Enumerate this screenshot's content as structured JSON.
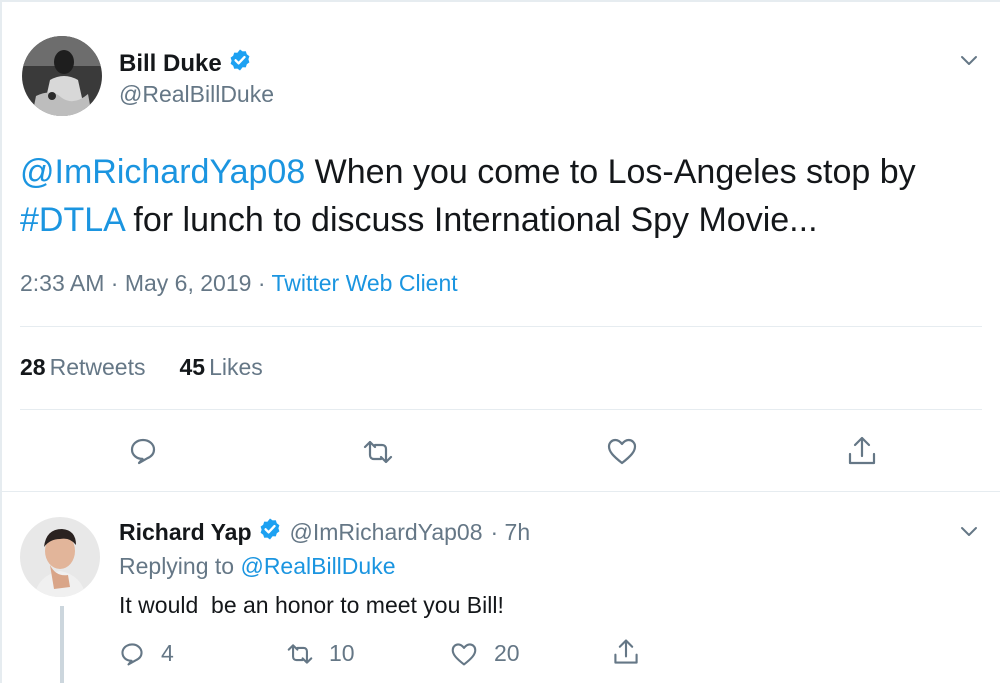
{
  "tweet": {
    "author_name": "Bill Duke",
    "author_handle": "@RealBillDuke",
    "text_mention": "@ImRichardYap08",
    "text_part1": " When you come to Los-Angeles stop by ",
    "text_hashtag": "#DTLA",
    "text_part2": " for lunch to discuss International Spy Movie...",
    "time": "2:33 AM",
    "sep1": " · ",
    "date": "May 6, 2019",
    "sep2": " · ",
    "client": "Twitter Web Client",
    "retweet_count": "28",
    "retweet_label": "Retweets",
    "like_count": "45",
    "like_label": "Likes"
  },
  "reply": {
    "author_name": "Richard Yap",
    "author_handle": "@ImRichardYap08",
    "age": "· 7h",
    "replying_to_label": "Replying to ",
    "replying_to_handle": "@RealBillDuke",
    "text": "It would  be an honor to meet you Bill!",
    "reply_count": "4",
    "retweet_count": "10",
    "like_count": "20"
  },
  "colors": {
    "link": "#1b95e0",
    "secondary_text": "#657786",
    "verified": "#1da1f2"
  },
  "icons": [
    "verified-icon",
    "chevron-down-icon",
    "reply-icon",
    "retweet-icon",
    "like-icon",
    "share-icon"
  ]
}
